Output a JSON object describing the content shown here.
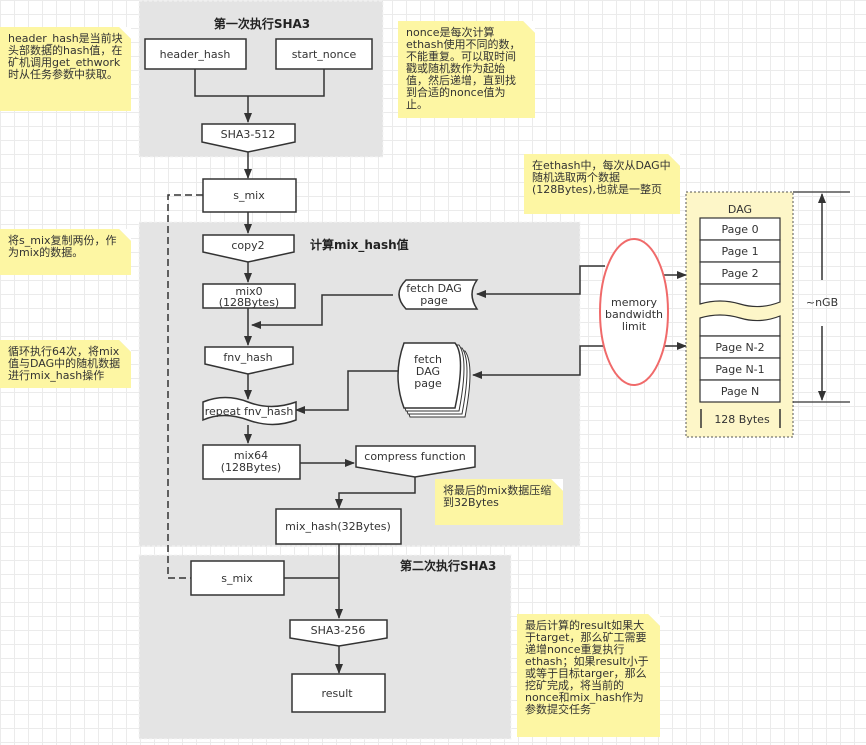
{
  "groups": {
    "sha3_first": "第一次执行SHA3",
    "mix_hash_calc": "计算mix_hash值",
    "sha3_second": "第二次执行SHA3"
  },
  "nodes": {
    "header_hash": "header_hash",
    "start_nonce": "start_nonce",
    "sha3_512": "SHA3-512",
    "s_mix": "s_mix",
    "copy2": "copy2",
    "mix0_line1": "mix0",
    "mix0_line2": "(128Bytes)",
    "fnv_hash": "fnv_hash",
    "repeat_fnv_hash": "repeat fnv_hash",
    "mix64_line1": "mix64",
    "mix64_line2": "(128Bytes)",
    "compress_function": "compress function",
    "mix_hash_32": "mix_hash(32Bytes)",
    "s_mix_2": "s_mix",
    "sha3_256": "SHA3-256",
    "result": "result",
    "fetch_dag_page_1_line1": "fetch DAG",
    "fetch_dag_page_1_line2": "page",
    "fetch_dag_page_2_line1": "fetch",
    "fetch_dag_page_2_line2": "DAG",
    "fetch_dag_page_2_line3": "page",
    "memory_line1": "memory",
    "memory_line2": "bandwidth",
    "memory_line3": "limit"
  },
  "dag": {
    "title": "DAG",
    "pages_top": [
      "Page 0",
      "Page 1",
      "Page 2"
    ],
    "pages_bottom": [
      "Page N-2",
      "Page N-1",
      "Page N"
    ],
    "page_size": "128 Bytes",
    "total_size": "~nGB"
  },
  "notes": {
    "header_hash_note": "header_hash是当前块\n头部数据的hash值，在\n矿机调用get_ethwork\n时从任务参数中获取。",
    "nonce_note": "nonce是每次计算\nethash使用不同的数，\n不能重复。可以取时间\n戳或随机数作为起始\n值，然后递增，直到找\n到合适的nonce值为\n止。",
    "dag_note": "在ethash中，每次从DAG中\n随机选取两个数据\n(128Bytes),也就是一整页",
    "copy_note": "将s_mix复制两份，作\n为mix的数据。",
    "loop_note": "循环执行64次，将mix\n值与DAG中的随机数据\n进行mix_hash操作",
    "compress_note": "将最后的mix数据压缩\n到32Bytes",
    "result_note": "最后计算的result如果大\n于target，那么矿工需要\n递增nonce重复执行\nethash；如果result小于\n或等于目标targer，那么\n挖矿完成，将当前的\nnonce和mix_hash作为\n参数提交任务"
  },
  "colors": {
    "group_bg": "#e4e4e4",
    "note_bg": "#fdf6a3",
    "memory_border": "#f06a6a",
    "dag_bg": "#fdf6c8",
    "stroke": "#333333"
  }
}
